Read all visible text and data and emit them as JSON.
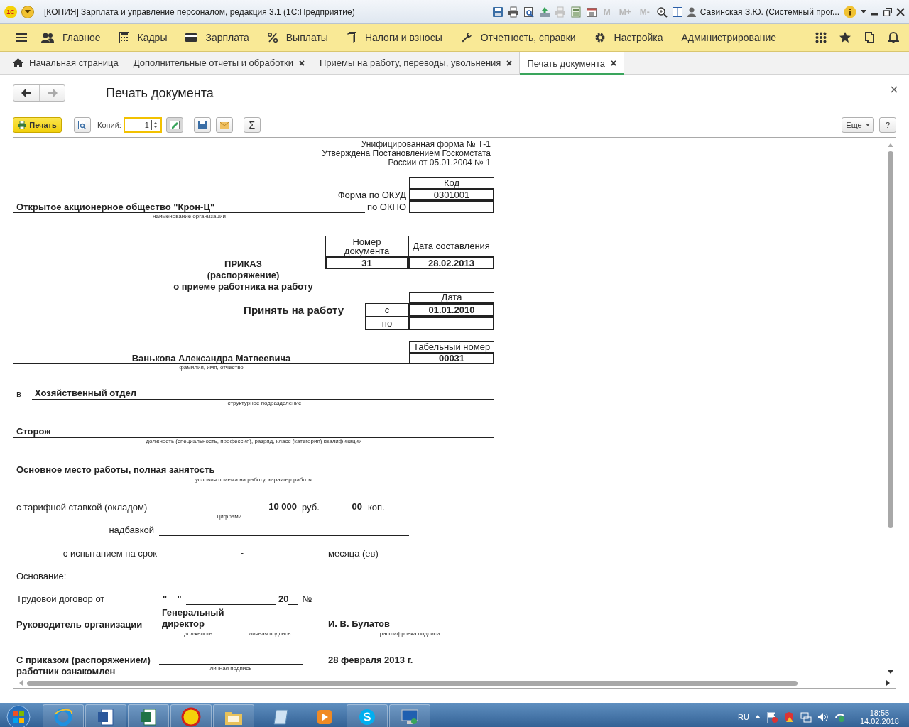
{
  "window": {
    "logo": "1С",
    "title": "[КОПИЯ] Зарплата и управление персоналом, редакция 3.1  (1С:Предприятие)",
    "memory_buttons": [
      "M",
      "M+",
      "M-"
    ],
    "user": "Савинская З.Ю. (Системный прог..."
  },
  "sections": [
    {
      "label": "Главное"
    },
    {
      "label": "Кадры"
    },
    {
      "label": "Зарплата"
    },
    {
      "label": "Выплаты"
    },
    {
      "label": "Налоги и взносы"
    },
    {
      "label": "Отчетность, справки"
    },
    {
      "label": "Настройка"
    },
    {
      "label": "Администрирование"
    }
  ],
  "tabs": [
    {
      "label": "Начальная страница",
      "closable": false,
      "selected": false
    },
    {
      "label": "Дополнительные отчеты и обработки",
      "closable": true,
      "selected": false
    },
    {
      "label": "Приемы на работу, переводы, увольнения",
      "closable": true,
      "selected": false
    },
    {
      "label": "Печать документа",
      "closable": true,
      "selected": true
    }
  ],
  "form": {
    "title": "Печать документа",
    "print_button": "Печать",
    "copies_label": "Копий:",
    "copies_value": "1",
    "sum_button": "Σ",
    "more_button": "Еще",
    "help_button": "?"
  },
  "document": {
    "header_lines": [
      "Унифицированная форма № Т-1",
      "Утверждена Постановлением Госкомстата",
      "России от 05.01.2004 № 1"
    ],
    "code_header": "Код",
    "okud_label": "Форма по ОКУД",
    "okud": "0301001",
    "okpo_label": "по ОКПО",
    "organization": "Открытое акционерное общество \"Крон-Ц\"",
    "organization_caption": "наименование организации",
    "doc_number_header": "Номер документа",
    "doc_date_header": "Дата составления",
    "doc_number": "31",
    "doc_date": "28.02.2013",
    "title_lines": [
      "ПРИКАЗ",
      "(распоряжение)",
      "о приеме работника на работу"
    ],
    "hire_label": "Принять на работу",
    "date_header": "Дата",
    "from_label": "с",
    "from_date": "01.01.2010",
    "to_label": "по",
    "personnel_number_header": "Табельный номер",
    "personnel_number": "00031",
    "employee": "Ванькова Александра Матвеевича",
    "employee_caption": "фамилия, имя, отчество",
    "department_prefix": "в",
    "department": "Хозяйственный отдел",
    "department_caption": "структурное подразделение",
    "position": "Сторож",
    "position_caption": "должность (специальность, профессия), разряд, класс (категория) квалификации",
    "conditions": "Основное место работы, полная занятость",
    "conditions_caption": "условия приема на работу, характер работы",
    "rate_label": "с тарифной ставкой (окладом)",
    "rate": "10 000",
    "rub": "руб.",
    "kopecks": "00",
    "kop": "коп.",
    "rate_caption": "цифрами",
    "bonus_label": "надбавкой",
    "probation_label": "с испытанием на срок",
    "probation_value": "-",
    "probation_unit": "месяца (ев)",
    "basis_label": "Основание:",
    "contract_label": "Трудовой договор от",
    "contract_quotes": "\"    \"",
    "contract_year": "20",
    "contract_no": "№",
    "head_label": "Руководитель организации",
    "head_position": "Генеральный директор",
    "head_name": "И. В. Булатов",
    "position_sign_caption": "должность",
    "signature_caption": "личная подпись",
    "name_caption": "расшифровка  подписи",
    "ack_label": "С приказом (распоряжением) работник ознакомлен",
    "ack_caption": "личная подпись",
    "ack_date": "28 февраля 2013 г."
  },
  "taskbar": {
    "language": "RU",
    "time": "18:55",
    "date": "14.02.2018"
  }
}
